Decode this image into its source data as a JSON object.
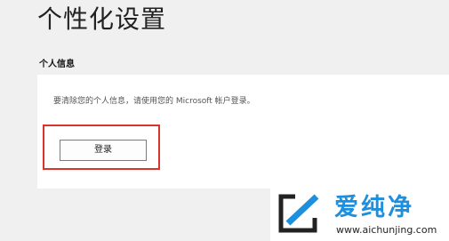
{
  "page": {
    "title": "个性化设置"
  },
  "personal_info": {
    "heading": "个人信息",
    "description": "要清除您的个人信息，请使用您的 Microsoft 帐户登录。",
    "signin_button_label": "登录"
  },
  "colors": {
    "background": "#f0f0f0",
    "panel": "#ffffff",
    "highlight_border": "#d9352a",
    "watermark_accent": "#1d8fdc"
  },
  "watermark": {
    "name": "爱纯净",
    "url": "www.aichunjing.com",
    "icon": "site-logo-icon"
  }
}
